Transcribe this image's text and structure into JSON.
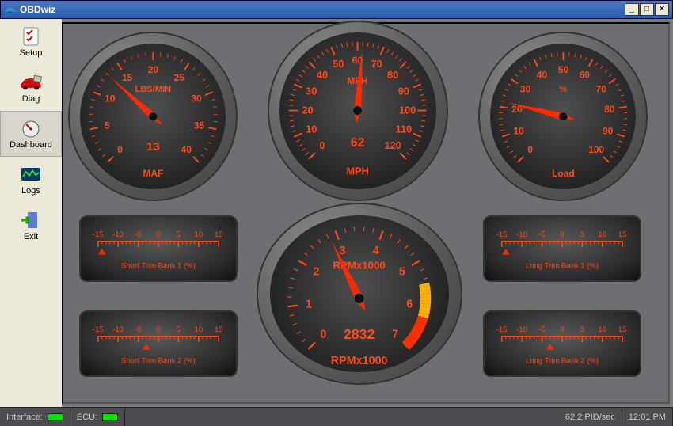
{
  "window": {
    "title": "OBDwiz"
  },
  "sidebar": {
    "items": [
      {
        "label": "Setup"
      },
      {
        "label": "Diag"
      },
      {
        "label": "Dashboard"
      },
      {
        "label": "Logs"
      },
      {
        "label": "Exit"
      }
    ]
  },
  "gauges": {
    "maf": {
      "label": "MAF",
      "unit": "LBS/MIN",
      "min": 0,
      "max": 40,
      "value": 13,
      "value_display": "13",
      "ticks": [
        0,
        5,
        10,
        15,
        20,
        25,
        30,
        35,
        40
      ]
    },
    "mph": {
      "label": "MPH",
      "unit": "MPH",
      "min": 0,
      "max": 120,
      "value": 62,
      "value_display": "62",
      "ticks": [
        0,
        10,
        20,
        30,
        40,
        50,
        60,
        70,
        80,
        90,
        100,
        110,
        120
      ]
    },
    "load": {
      "label": "Load",
      "unit": "%",
      "min": 0,
      "max": 100,
      "value": 22,
      "ticks": [
        0,
        10,
        20,
        30,
        40,
        50,
        60,
        70,
        80,
        90,
        100
      ]
    },
    "rpm": {
      "label": "RPMx1000",
      "unit": "RPMx1000",
      "min": 0,
      "max": 7,
      "value": 2.832,
      "value_display": "2832",
      "ticks": [
        0,
        1,
        2,
        3,
        4,
        5,
        6,
        7
      ],
      "redline_start": 5.5
    }
  },
  "trims": {
    "st1": {
      "label": "Short Trim Bank 1 (%)",
      "min": -15,
      "max": 15,
      "value": -14,
      "ticks": [
        -15,
        -10,
        -5,
        0,
        5,
        10,
        15
      ]
    },
    "st2": {
      "label": "Short Trim Bank 2 (%)",
      "min": -15,
      "max": 15,
      "value": -3,
      "ticks": [
        -15,
        -10,
        -5,
        0,
        5,
        10,
        15
      ]
    },
    "lt1": {
      "label": "Long Trim Bank 1 (%)",
      "min": -15,
      "max": 15,
      "value": -14,
      "ticks": [
        -15,
        -10,
        -5,
        0,
        5,
        10,
        15
      ]
    },
    "lt2": {
      "label": "Long Trim Bank 2 (%)",
      "min": -15,
      "max": 15,
      "value": -3,
      "ticks": [
        -15,
        -10,
        -5,
        0,
        5,
        10,
        15
      ]
    }
  },
  "status": {
    "iface_label": "Interface:",
    "ecu_label": "ECU:",
    "pid_rate": "62.2 PID/sec",
    "clock": "12:01 PM"
  },
  "colors": {
    "accent": "#ff4a1a",
    "needle": "#ff2a00"
  }
}
